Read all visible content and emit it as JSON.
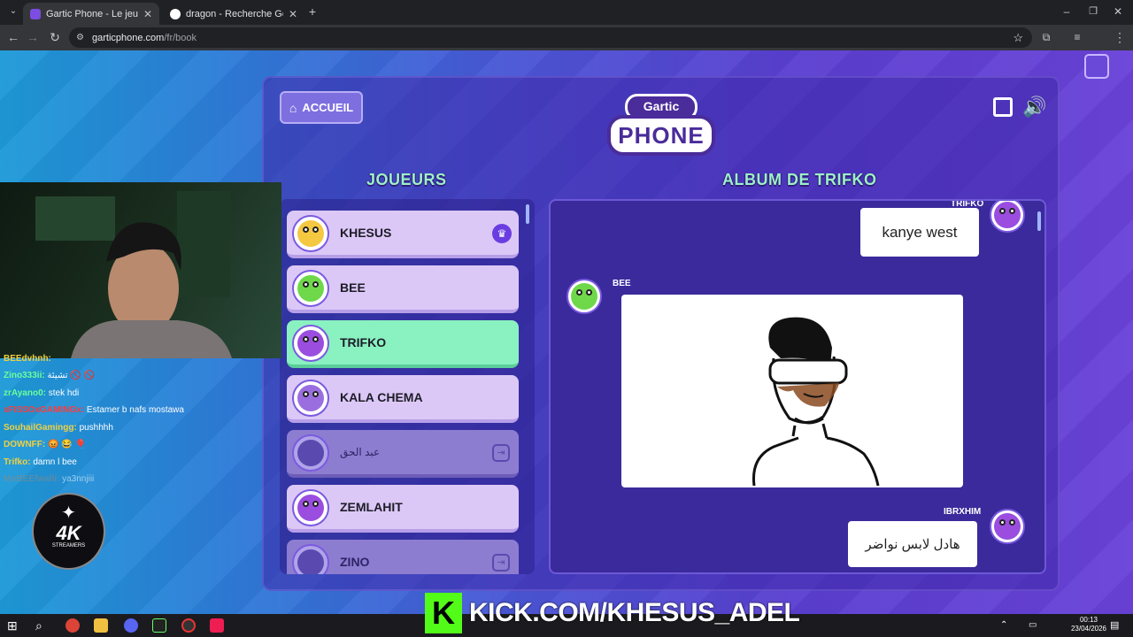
{
  "browser": {
    "tabs": [
      {
        "title": "Gartic Phone - Le jeu du téléph",
        "active": true
      },
      {
        "title": "dragon - Recherche Google",
        "active": false
      }
    ],
    "url_host": "garticphone.com",
    "url_path": "/fr/book"
  },
  "game": {
    "home_label": "ACCUEIL",
    "logo_top": "Gartic",
    "logo_bottom": "PHONE",
    "players_heading": "JOUEURS",
    "album_heading": "ALBUM DE TRIFKO",
    "players": [
      {
        "name": "KHESUS",
        "state": "host",
        "face_color": "#f5c842"
      },
      {
        "name": "BEE",
        "state": "normal",
        "face_color": "#6ed84a"
      },
      {
        "name": "TRIFKO",
        "state": "active",
        "face_color": "#9b4de0"
      },
      {
        "name": "KALA CHEMA",
        "state": "normal",
        "face_color": "#9b6ee0"
      },
      {
        "name": "عبد الحق",
        "state": "disabled",
        "face_color": "#5a4ab0"
      },
      {
        "name": "ZEMLAHIT",
        "state": "normal",
        "face_color": "#9b4de0"
      },
      {
        "name": "ZINO",
        "state": "disabled",
        "face_color": "#5a4ab0"
      }
    ],
    "album": {
      "msg1_author": "TRIFKO",
      "msg1_text": "kanye west",
      "msg2_author": "BEE",
      "msg3_author": "IBRXHIM",
      "msg3_text": "هادل لابس نواضر"
    }
  },
  "stream": {
    "chat": [
      {
        "user": "BEEdvhnh:",
        "text": "",
        "user_color": "#f0d040"
      },
      {
        "user": "Zino333ii:",
        "text": "تشيئة 🚫 🚫",
        "user_color": "#6aff9a"
      },
      {
        "user": "zrAyano0:",
        "text": "stek hdi",
        "user_color": "#6aff9a"
      },
      {
        "user": "xFISSOxGAMINGx:",
        "text": "Estamer b nafs mostawa",
        "user_color": "#ff3b3b"
      },
      {
        "user": "SouhailGamingg:",
        "text": "pushhhh",
        "user_color": "#f0d040"
      },
      {
        "user": "DOWNFF:",
        "text": "😡 😂 🎈",
        "user_color": "#f0d040"
      },
      {
        "user": "Trifko:",
        "text": "damn l bee",
        "user_color": "#f0d040"
      },
      {
        "user": "MoBEEfwalli:",
        "text": "ya3nnjiii",
        "user_color": "#8a8a8a"
      }
    ],
    "overlay_logo_big": "4K",
    "overlay_logo_small": "STREAMERS",
    "kick_text": "KICK.COM/KHESUS_ADEL"
  },
  "taskbar": {
    "time": "00:13",
    "date": "23/04/2026"
  }
}
